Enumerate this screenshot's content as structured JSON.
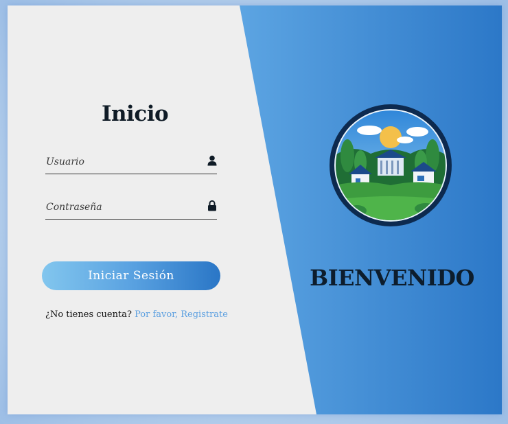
{
  "login": {
    "title": "Inicio",
    "username_placeholder": "Usuario",
    "password_placeholder": "Contraseña",
    "submit_label": "Iniciar Sesión",
    "no_account_text": "¿No tienes cuenta?",
    "register_link": "Por favor, Registrate"
  },
  "welcome": {
    "heading": "BIENVENIDO"
  },
  "icons": {
    "username": "user-icon",
    "password": "lock-icon",
    "logo": "town-landscape-logo"
  },
  "colors": {
    "card_background": "#eeeeee",
    "accent_light": "#82c6ee",
    "accent_dark": "#2a76c6",
    "link": "#5b9fe0",
    "text_dark": "#0f1b26"
  }
}
